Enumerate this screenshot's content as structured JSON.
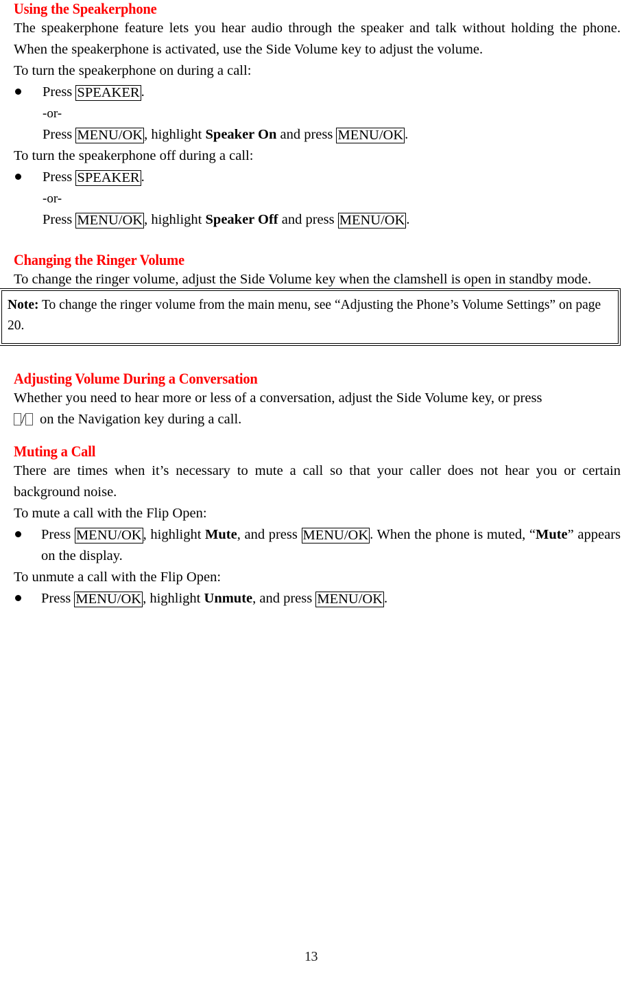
{
  "document": {
    "page_number": "13",
    "heading_color": "#FF0000",
    "text_color": "#000000"
  },
  "sections": [
    {
      "id": "using-the-speakerphone",
      "heading": "Using the Speakerphone",
      "intro": "The speakerphone feature lets you hear audio through the speaker and talk without holding the phone. When the speakerphone is activated, use the Side Volume key to adjust the volume.",
      "lead_on": "To turn the speakerphone on during a call:",
      "on_bullet": {
        "press_word": "Press",
        "key": "SPEAKER",
        "period": "."
      },
      "or_label": "-or-",
      "on_alt": {
        "press_word": "Press",
        "key1": "MENU/OK",
        "mid": ", highlight",
        "menu_item": "Speaker On",
        "and_press": "and press",
        "key2": "MENU/OK",
        "period": "."
      },
      "lead_off": "To turn the speakerphone off during a call:",
      "off_bullet": {
        "press_word": "Press",
        "key": "SPEAKER",
        "period": "."
      },
      "off_alt": {
        "press_word": "Press",
        "key1": "MENU/OK",
        "mid": ", highlight",
        "menu_item": "Speaker Off",
        "and_press": "and press",
        "key2": "MENU/OK",
        "period": "."
      }
    },
    {
      "id": "changing-the-ringer-volume",
      "heading": "Changing the Ringer Volume",
      "body": "To change the ringer volume, adjust the Side Volume key when the clamshell is open in standby mode.",
      "note": {
        "label": "Note:",
        "text": " To change the ringer volume from the main menu, see “Adjusting the Phone’s Volume Settings” on page 20."
      }
    },
    {
      "id": "adjusting-volume-during-a-conversation",
      "heading": "Adjusting Volume During a Conversation",
      "body_part1": "Whether you need to hear more or less of a conversation, adjust the Side Volume key, or press",
      "glyph_separator": "/",
      "body_part2": "on the Navigation key during a call."
    },
    {
      "id": "muting-a-call",
      "heading": "Muting a Call",
      "intro": "There are times when it’s necessary to mute a call so that your caller does not hear you or certain background noise.",
      "lead_mute": "To mute a call with the Flip Open:",
      "mute_bullet": {
        "press_word": "Press",
        "key1": "MENU/OK",
        "mid": ", highlight",
        "menu_item": "Mute",
        "and_press": ", and press",
        "key2": "MENU/OK",
        "tail": ". When the phone is muted,",
        "quote_open": "“",
        "display_word": "Mute",
        "quote_close": "”",
        "tail2": " appears on the display."
      },
      "lead_unmute": "To unmute a call with the Flip Open:",
      "unmute_bullet": {
        "press_word": "Press",
        "key1": "MENU/OK",
        "mid": ", highlight",
        "menu_item": "Unmute",
        "and_press": ", and press",
        "key2": "MENU/OK",
        "period": "."
      }
    }
  ]
}
